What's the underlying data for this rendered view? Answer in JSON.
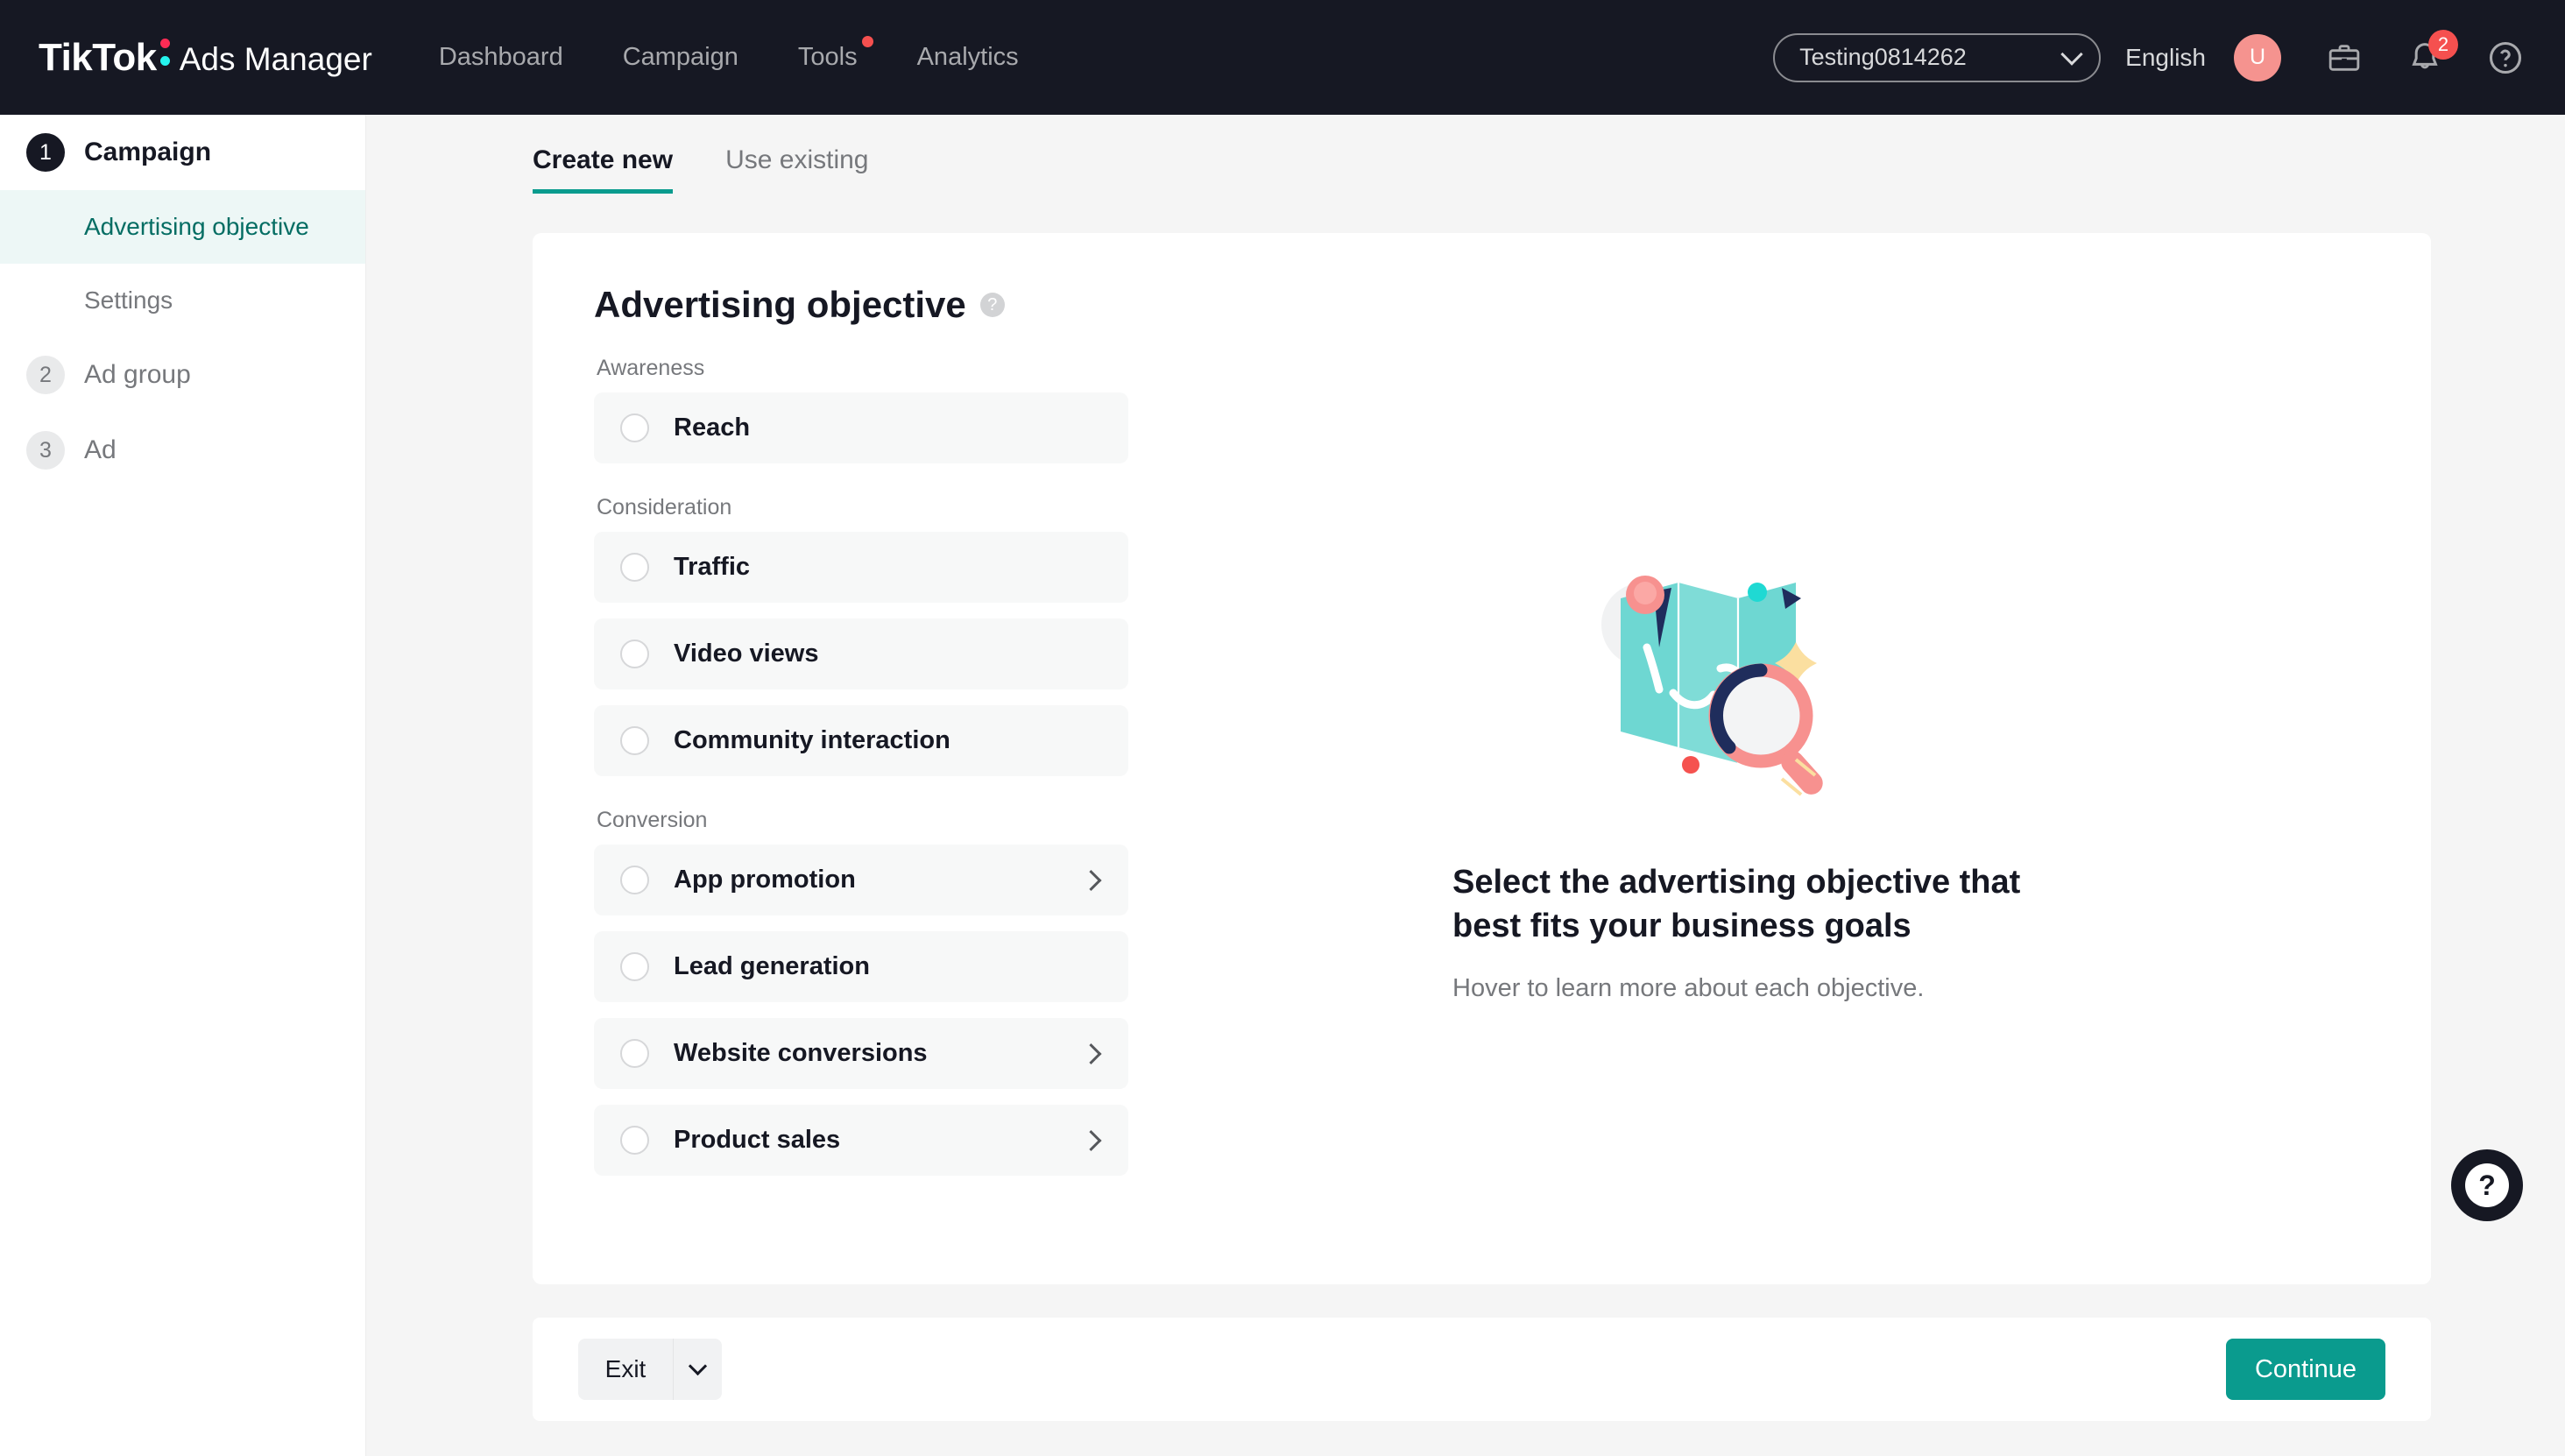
{
  "topbar": {
    "logo_main": "TikTok",
    "logo_sub": "Ads Manager",
    "nav": [
      {
        "label": "Dashboard",
        "dot": false
      },
      {
        "label": "Campaign",
        "dot": false
      },
      {
        "label": "Tools",
        "dot": true
      },
      {
        "label": "Analytics",
        "dot": false
      }
    ],
    "account": "Testing0814262",
    "language": "English",
    "avatar_initial": "U",
    "briefcase_icon": "briefcase-icon",
    "bell_icon": "bell-icon",
    "notification_count": "2",
    "help_icon": "help-circle-icon",
    "background": "#161823"
  },
  "sidebar": {
    "steps": [
      {
        "num": "1",
        "label": "Campaign",
        "active": true
      },
      {
        "num": "2",
        "label": "Ad group",
        "active": false
      },
      {
        "num": "3",
        "label": "Ad",
        "active": false
      }
    ],
    "campaign_subitems": [
      {
        "label": "Advertising objective",
        "active": true
      },
      {
        "label": "Settings",
        "active": false
      }
    ],
    "active_color": "#046d63"
  },
  "main": {
    "tabs": [
      {
        "label": "Create new",
        "active": true
      },
      {
        "label": "Use existing",
        "active": false
      }
    ],
    "section_title": "Advertising objective",
    "section_help_icon": "help-circle-icon",
    "groups": [
      {
        "label": "Awareness",
        "options": [
          {
            "label": "Reach",
            "has_arrow": false,
            "selected": false
          }
        ]
      },
      {
        "label": "Consideration",
        "options": [
          {
            "label": "Traffic",
            "has_arrow": false,
            "selected": false
          },
          {
            "label": "Video views",
            "has_arrow": false,
            "selected": false
          },
          {
            "label": "Community interaction",
            "has_arrow": false,
            "selected": false
          }
        ]
      },
      {
        "label": "Conversion",
        "options": [
          {
            "label": "App promotion",
            "has_arrow": true,
            "selected": false
          },
          {
            "label": "Lead generation",
            "has_arrow": false,
            "selected": false
          },
          {
            "label": "Website conversions",
            "has_arrow": true,
            "selected": false
          },
          {
            "label": "Product sales",
            "has_arrow": true,
            "selected": false
          }
        ]
      }
    ],
    "promo": {
      "illustration": "map-and-magnifier-illustration",
      "title": "Select the advertising objective that best fits your business goals",
      "subtitle": "Hover to learn more about each objective."
    }
  },
  "footer": {
    "exit_label": "Exit",
    "exit_chevron_icon": "chevron-down-icon",
    "continue_label": "Continue",
    "continue_color": "#0a9b8e"
  },
  "fab": {
    "icon": "question-mark-icon",
    "glyph": "?"
  }
}
